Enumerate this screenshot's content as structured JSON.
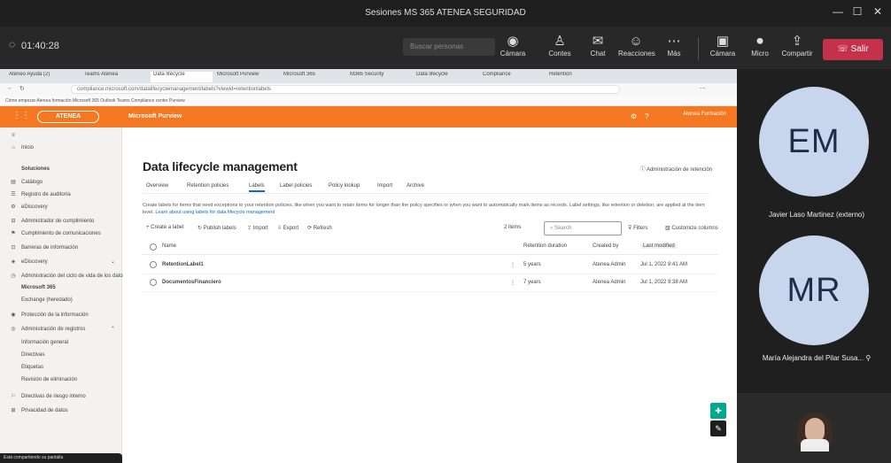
{
  "teams": {
    "window_title": "Sesiones MS 365 ATENEA SEGURIDAD",
    "timer": "01:40:28",
    "search_placeholder": "Buscar personas",
    "buttons": [
      {
        "key": "camera",
        "label": "Cámara",
        "icon": "camera-icon"
      },
      {
        "key": "people",
        "label": "Contes",
        "icon": "people-icon"
      },
      {
        "key": "chat",
        "label": "Chat",
        "icon": "chat-icon"
      },
      {
        "key": "reactions",
        "label": "Reacciones",
        "icon": "reactions-icon"
      },
      {
        "key": "more",
        "label": "Más",
        "icon": "more-icon"
      },
      {
        "key": "camera2",
        "label": "Cámara",
        "icon": "video-icon"
      },
      {
        "key": "mic",
        "label": "Micro",
        "icon": "mic-icon"
      },
      {
        "key": "share",
        "label": "Compartir",
        "icon": "share-icon"
      }
    ],
    "leave_label": "Salir",
    "window_controls": [
      "—",
      "☐",
      "✕"
    ]
  },
  "browser": {
    "tabs": [
      "Ateneo Ayuda (2)",
      "Teams Atenea",
      "Data lifecycle",
      "Microsoft Purview",
      "Microsoft 365",
      "M365 Security",
      "Data lifecycle",
      "Compliance",
      "Retention"
    ],
    "address": "compliance.microsoft.com/datalifecyclemanagement/labels?viewid=retentionlabels",
    "favorites": "Cómo empezar   Atenea formación   Microsoft 365   Outlook   Teams   Compliance center   Purview"
  },
  "app": {
    "logo_text": "ATENEA",
    "app_name": "Microsoft Purview",
    "user_pill": "Atenea Formación"
  },
  "leftnav": {
    "items": [
      {
        "icon": "≡",
        "label": ""
      },
      {
        "icon": "⌂",
        "label": "Inicio"
      },
      {
        "icon": "",
        "label": "Soluciones"
      },
      {
        "icon": "▤",
        "label": "Catálogo"
      },
      {
        "icon": "☰",
        "label": "Registro de auditoría"
      },
      {
        "icon": "⚙",
        "label": "eDiscovery"
      },
      {
        "icon": "⊟",
        "label": "Administrador de cumplimiento"
      },
      {
        "icon": "⚑",
        "label": "Cumplimiento de comunicaciones"
      },
      {
        "icon": "⊡",
        "label": "Barreras de información"
      },
      {
        "icon": "◈",
        "label": "eDiscovery"
      },
      {
        "icon": "◷",
        "label": "Administración del ciclo de vida de los datos"
      },
      {
        "icon": "",
        "label": "Microsoft 365"
      },
      {
        "icon": "",
        "label": "Exchange (heredado)"
      },
      {
        "icon": "◉",
        "label": "Protección de la información"
      },
      {
        "icon": "◎",
        "label": "Administración de registros"
      },
      {
        "icon": "",
        "label": "Información general"
      },
      {
        "icon": "",
        "label": "Directivas"
      },
      {
        "icon": "",
        "label": "Etiquetas"
      },
      {
        "icon": "",
        "label": "Revisión de eliminación"
      },
      {
        "icon": "⚐",
        "label": "Directivas de riesgo interno"
      },
      {
        "icon": "⊞",
        "label": "Privacidad de datos"
      }
    ],
    "bottom_pill": "Está compartiendo su pantalla"
  },
  "page": {
    "title": "Data lifecycle management",
    "right_link": "Administración de retención",
    "subtabs": [
      "Overview",
      "Retention policies",
      "Labels",
      "Label policies",
      "Policy lookup",
      "Import",
      "Archive"
    ],
    "description": "Create labels for items that need exceptions to your retention policies, like when you want to retain items for longer than the policy specifies or when you want to automatically mark items as records. Label settings, like retention or deletion, are applied at the item level.",
    "description_link": "Learn about using labels for data lifecycle management",
    "commands": [
      "+ Create a label",
      "↻ Publish labels",
      "⇪ Import",
      "⇩ Export",
      "⟳ Refresh"
    ],
    "items_count": "2 items",
    "search_placeholder": "Search",
    "filter_label": "Filters",
    "customize_label": "Customize columns",
    "columns": [
      "Name",
      "Retention duration",
      "Created by",
      "Last modified"
    ],
    "rows": [
      {
        "name": "RetentionLabel1",
        "duration": "5 years",
        "created_by": "Atenea Admin",
        "modified": "Jul 1, 2022 9:41 AM"
      },
      {
        "name": "DocumentosFinanciero",
        "duration": "7 years",
        "created_by": "Atenea Admin",
        "modified": "Jul 1, 2022 9:38 AM"
      }
    ]
  },
  "participants": [
    {
      "initials": "EM",
      "name": "Javier Laso Martinez (externo)"
    },
    {
      "initials": "MR",
      "name": "María Alejandra del Pilar Susa..."
    }
  ]
}
